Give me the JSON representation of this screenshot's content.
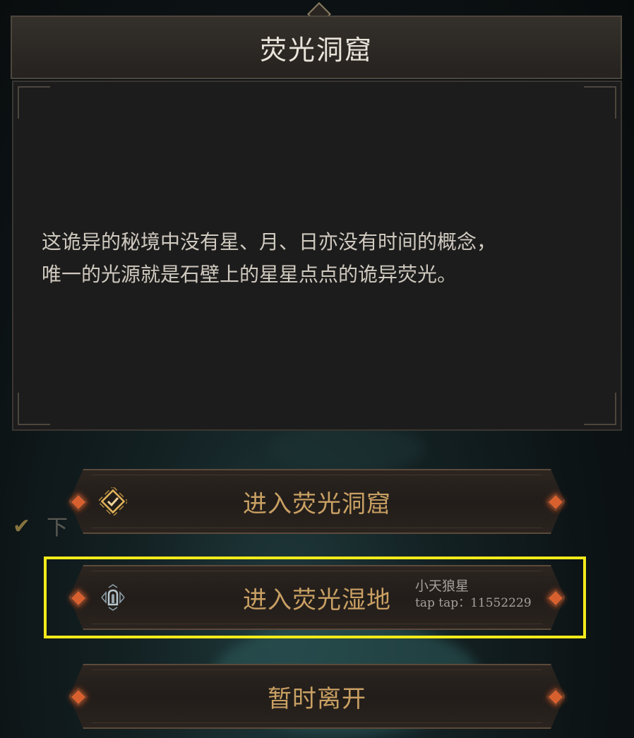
{
  "dialog": {
    "title": "荧光洞窟",
    "description_line1": "这诡异的秘境中没有星、月、日亦没有时间的概念，",
    "description_line2": "唯一的光源就是石壁上的星星点点的诡异荧光。"
  },
  "background": {
    "obscured_label": "下"
  },
  "buttons": {
    "enter_cave": {
      "label": "进入荧光洞窟",
      "icon": "checkmark-diamond-icon"
    },
    "enter_wetland": {
      "label": "进入荧光湿地",
      "icon": "tombstone-gate-icon"
    },
    "leave": {
      "label": "暂时离开"
    }
  },
  "watermark": {
    "line1": "小天狼星",
    "line2": "tap tap：11552229"
  },
  "colors": {
    "highlight": "#f2ea1a",
    "button_text": "#c9a063",
    "gem": "#d8602e"
  }
}
